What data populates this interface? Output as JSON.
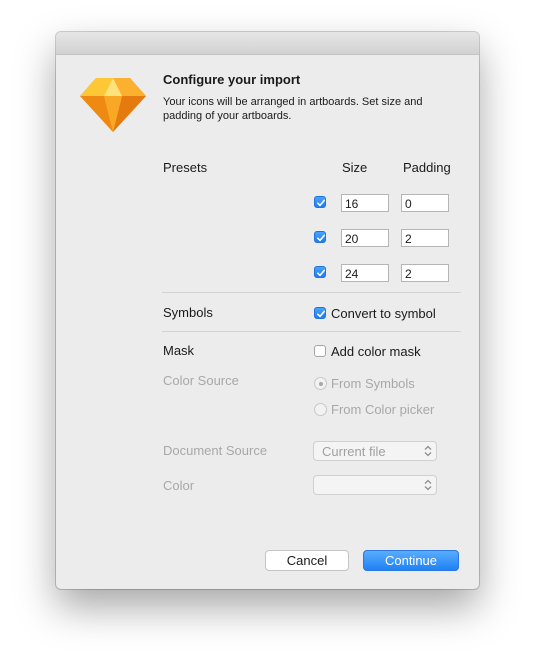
{
  "dialog": {
    "title": "Configure your import",
    "subtitle": "Your icons will be arranged in artboards. Set size and padding of your artboards."
  },
  "presets": {
    "label": "Presets",
    "size_header": "Size",
    "padding_header": "Padding",
    "rows": [
      {
        "checked": true,
        "size": "16",
        "padding": "0"
      },
      {
        "checked": true,
        "size": "20",
        "padding": "2"
      },
      {
        "checked": true,
        "size": "24",
        "padding": "2"
      }
    ]
  },
  "symbols": {
    "label": "Symbols",
    "option_label": "Convert to symbol",
    "checked": true
  },
  "mask": {
    "label": "Mask",
    "option_label": "Add color mask",
    "checked": false,
    "color_source_label": "Color Source",
    "radio_from_symbols": "From Symbols",
    "radio_from_picker": "From Color picker",
    "selected": "From Symbols",
    "document_source_label": "Document Source",
    "document_source_value": "Current file",
    "color_label": "Color",
    "color_value": ""
  },
  "buttons": {
    "cancel": "Cancel",
    "continue": "Continue"
  },
  "colors": {
    "accent": "#1e82f5",
    "disabled_text": "#a8a8a8",
    "app_icon": "#f7a21b"
  },
  "icons": {
    "app": "sketch-diamond-icon",
    "checkmark": "checkmark-icon",
    "popup": "chevron-up-down-icon"
  }
}
